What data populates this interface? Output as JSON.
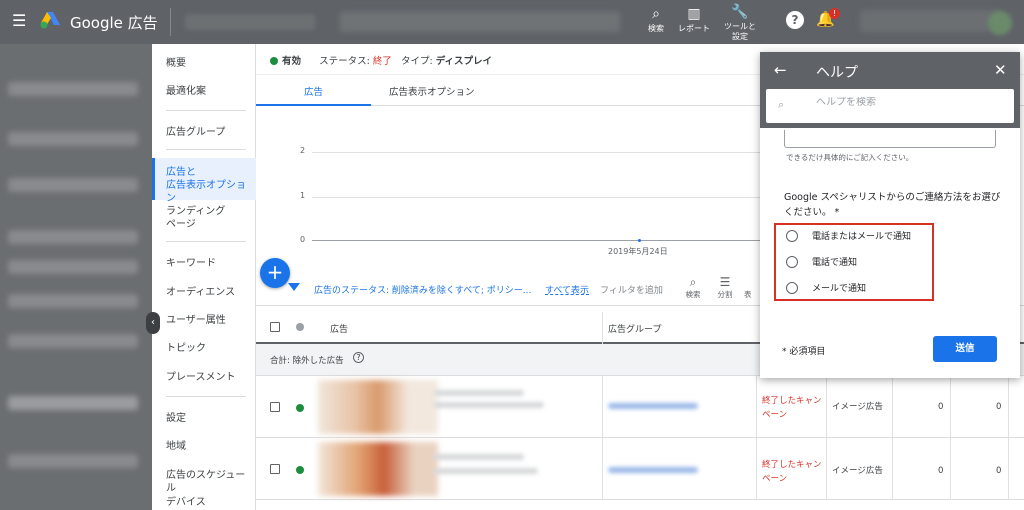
{
  "topbar": {
    "app_name": "Google 広告",
    "tools": [
      {
        "icon": "search-icon",
        "label": "検索"
      },
      {
        "icon": "report-icon",
        "label": "レポート"
      },
      {
        "icon": "wrench-icon",
        "label": "ツールと\n設定"
      }
    ],
    "notification_count": "!"
  },
  "nav": {
    "items": [
      {
        "label": "概要"
      },
      {
        "label": "最適化案"
      },
      {
        "label": "広告グループ"
      },
      {
        "label": "広告と\n広告表示オプション",
        "active": true
      },
      {
        "label": "ランディング\nページ"
      },
      {
        "label": "キーワード"
      },
      {
        "label": "オーディエンス"
      },
      {
        "label": "ユーザー属性"
      },
      {
        "label": "トピック"
      },
      {
        "label": "プレースメント"
      },
      {
        "label": "設定"
      },
      {
        "label": "地域"
      },
      {
        "label": "広告のスケジュール"
      },
      {
        "label": "デバイス"
      }
    ]
  },
  "status": {
    "state": "有効",
    "status_label": "ステータス:",
    "status_value": "終了",
    "type_label": "タイプ:",
    "type_value": "ディスプレイ"
  },
  "tabs": [
    "広告",
    "広告表示オプション"
  ],
  "chart_data": {
    "type": "line",
    "x": [
      "2019年5月24日"
    ],
    "y_ticks": [
      "2",
      "1",
      "0"
    ],
    "series": [
      {
        "values": [
          0
        ]
      }
    ],
    "ylim": [
      0,
      2
    ]
  },
  "filter": {
    "text": "広告のステータス: 削除済みを除くすべて; ポリシー...",
    "show_all": "すべて表示",
    "add_filter": "フィルタを追加",
    "actions": [
      {
        "icon": "search-icon",
        "label": "検索"
      },
      {
        "icon": "segment-icon",
        "label": "分割"
      },
      {
        "label": "表"
      }
    ]
  },
  "table": {
    "headers": [
      "広告",
      "広告グループ"
    ],
    "total_label": "合計: 除外した広告",
    "rows": [
      {
        "status": "終了したキャンペーン",
        "type": "イメージ広告",
        "v1": "0",
        "v2": "0"
      },
      {
        "status": "終了したキャンペーン",
        "type": "イメージ広告",
        "v1": "0",
        "v2": "0"
      }
    ]
  },
  "help_panel": {
    "title": "ヘルプ",
    "search_placeholder": "ヘルプを検索",
    "hint": "できるだけ具体的にご記入ください。",
    "question": "Google スペシャリストからのご連絡方法をお選びください。 *",
    "options": [
      "電話またはメールで通知",
      "電話で通知",
      "メールで通知"
    ],
    "required_note": "* 必須項目",
    "submit": "送信"
  }
}
